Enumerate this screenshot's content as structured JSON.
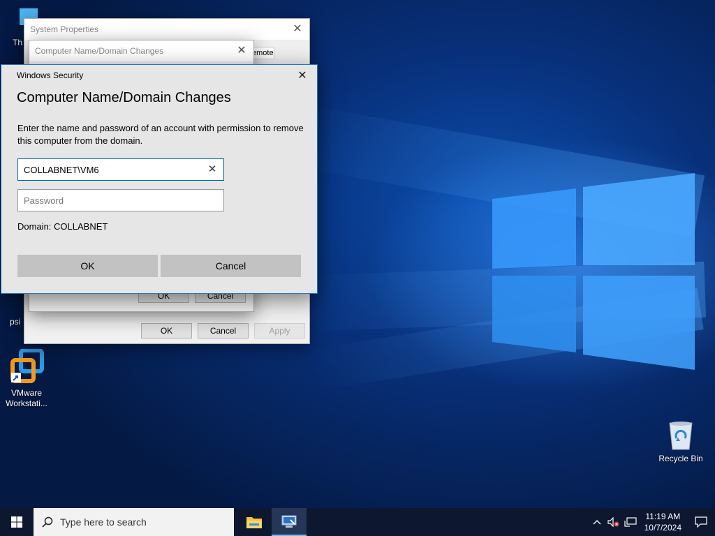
{
  "desktop": {
    "icons": [
      {
        "label": "Th"
      },
      {
        "label": "psi"
      },
      {
        "label": "VMware Workstati..."
      },
      {
        "label": "Recycle Bin"
      }
    ]
  },
  "system_properties": {
    "title": "System Properties",
    "tab_partial": "emote",
    "ok_label": "OK",
    "cancel_label": "Cancel",
    "apply_label": "Apply"
  },
  "name_changes": {
    "title": "Computer Name/Domain Changes",
    "ok_label": "OK",
    "cancel_label": "Cancel"
  },
  "security_dialog": {
    "title": "Windows Security",
    "heading": "Computer Name/Domain Changes",
    "description": "Enter the name and password of an account with permission to remove this computer from the domain.",
    "username_value": "COLLABNET\\VM6",
    "password_placeholder": "Password",
    "domain_text": "Domain: COLLABNET",
    "ok_label": "OK",
    "cancel_label": "Cancel"
  },
  "taskbar": {
    "search_placeholder": "Type here to search",
    "time": "11:19 AM",
    "date": "10/7/2024"
  },
  "colors": {
    "accent": "#0067c0",
    "dialog_border": "#1e73d7",
    "taskbar": "#0e1730"
  }
}
